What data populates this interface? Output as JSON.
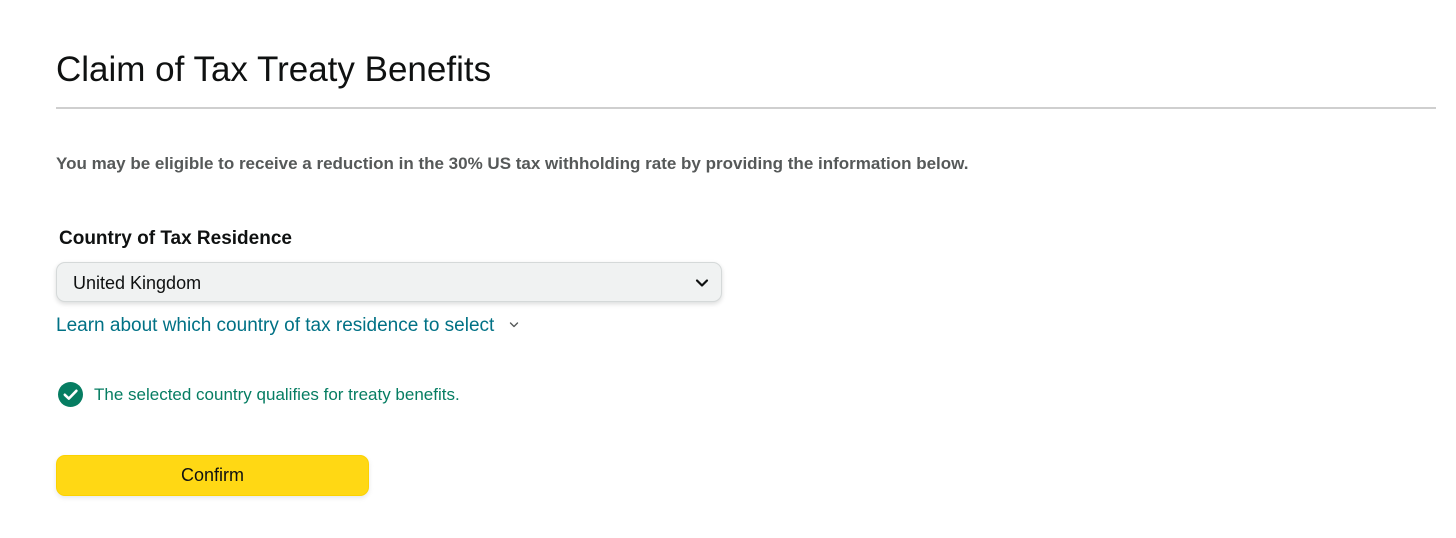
{
  "page": {
    "title": "Claim of Tax Treaty Benefits",
    "intro": "You may be eligible to receive a reduction in the 30% US tax withholding rate by providing the information below."
  },
  "country_field": {
    "label": "Country of Tax Residence",
    "selected_value": "United Kingdom",
    "chevron_icon": "chevron-down-icon"
  },
  "help_link": {
    "label": "Learn about which country of tax residence to select",
    "icon": "chevron-down-icon"
  },
  "status": {
    "icon": "check-circle-icon",
    "text": "The selected country qualifies for treaty benefits."
  },
  "actions": {
    "confirm_label": "Confirm"
  },
  "colors": {
    "link": "#007185",
    "success": "#067d62",
    "button": "#ffd814",
    "select_background": "#f0f2f2"
  }
}
